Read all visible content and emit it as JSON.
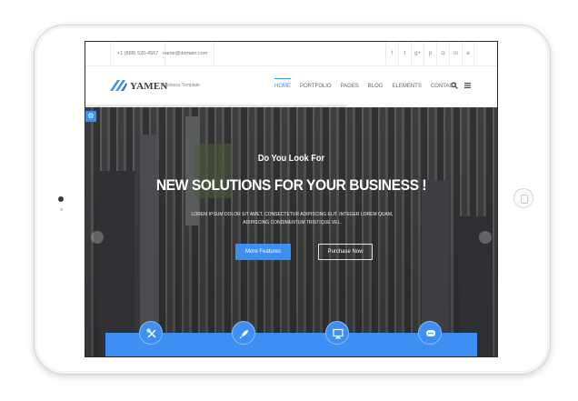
{
  "topbar": {
    "phone": "+1 (888) 520-4567",
    "email": "name@domain.com",
    "social_icons": [
      "facebook-icon",
      "twitter-icon",
      "google-plus-icon",
      "pinterest-icon",
      "instagram-icon",
      "linkedin-icon",
      "rss-icon"
    ],
    "social_glyphs": [
      "f",
      "t",
      "g+",
      "p",
      "◘",
      "in",
      "ʁ"
    ]
  },
  "nav": {
    "logo_name": "YAMEN",
    "logo_tagline": "Business Template",
    "items": [
      "HOME",
      "PORTFOLIO",
      "PAGES",
      "BLOG",
      "ELEMENTS",
      "CONTACT"
    ],
    "active_item": "HOME"
  },
  "hero": {
    "pre_title": "Do You Look For",
    "headline": "NEW SOLUTIONS FOR YOUR BUSINESS !",
    "text": "LOREM IPSUM DOLOR SIT AMET, CONSECTETUR ADIPISCING ELIT. INTEGER LOREM QUAM, ADIPISCING CONDIMENTUM TRISTIQUE VEL.",
    "primary_button": "More Features",
    "secondary_button": "Purchase Now"
  },
  "features": {
    "icons": [
      "tools-icon",
      "rocket-icon",
      "monitor-icon",
      "chat-bubble-icon"
    ]
  },
  "colors": {
    "accent": "#3d8ff3",
    "text_dark": "#3a3a3a",
    "text_muted": "#777777"
  }
}
